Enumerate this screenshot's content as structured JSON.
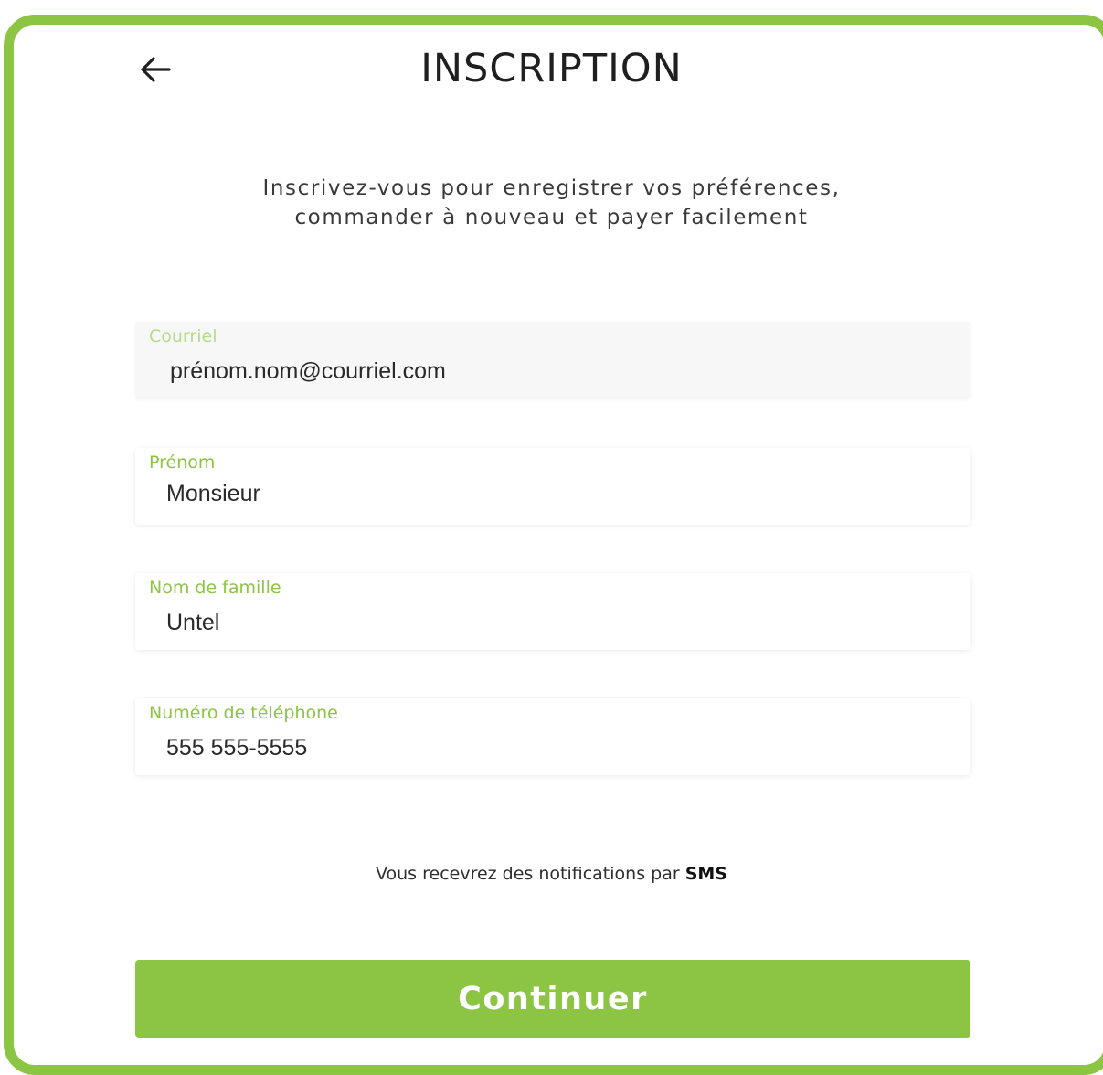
{
  "header": {
    "title": "INSCRIPTION",
    "back_icon": "arrow-left-icon"
  },
  "subtitle": {
    "line1": "Inscrivez-vous pour enregistrer vos préférences,",
    "line2": "commander à nouveau et payer facilement"
  },
  "form": {
    "email": {
      "label": "Courriel",
      "value": "prénom.nom@courriel.com"
    },
    "first_name": {
      "label": "Prénom",
      "value": "Monsieur"
    },
    "last_name": {
      "label": "Nom de famille",
      "value": "Untel"
    },
    "phone": {
      "label": "Numéro de téléphone",
      "value": "555 555-5555"
    }
  },
  "notice": {
    "text": "Vous recevrez des notifications par",
    "channel": "SMS"
  },
  "actions": {
    "continue_label": "Continuer"
  },
  "colors": {
    "accent": "#8cc443",
    "accent_light": "#b5dc89",
    "text": "#1f1f1f"
  }
}
